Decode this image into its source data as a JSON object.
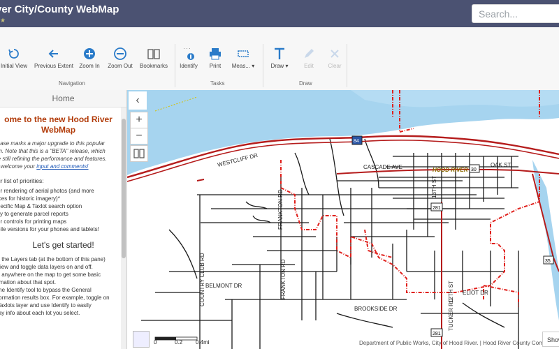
{
  "header": {
    "title": "ver City/County WebMap",
    "search_placeholder": "Search..."
  },
  "ribbon": {
    "tools": [
      {
        "label": "Initial View",
        "icon": "refresh-icon"
      },
      {
        "label": "Previous Extent",
        "icon": "arrow-left-icon"
      },
      {
        "label": "Zoom In",
        "icon": "plus-circle-icon"
      },
      {
        "label": "Zoom Out",
        "icon": "minus-circle-icon"
      },
      {
        "label": "Bookmarks",
        "icon": "book-icon"
      },
      {
        "label": "Identify",
        "icon": "identify-icon"
      },
      {
        "label": "Print",
        "icon": "printer-icon"
      },
      {
        "label": "Meas...",
        "icon": "measure-icon"
      },
      {
        "label": "Draw",
        "icon": "text-icon"
      },
      {
        "label": "Edit",
        "icon": "edit-icon"
      },
      {
        "label": "Clear",
        "icon": "close-icon"
      }
    ],
    "groups": {
      "navigation": "Navigation",
      "tasks": "Tasks",
      "draw": "Draw"
    }
  },
  "panel": {
    "header": "Home",
    "welcome_line1": "ome to the new Hood River",
    "welcome_line2": "WebMap",
    "para_lines": [
      "lease marks a major upgrade to this popular",
      "on.  Note that this is a \"BETA\" release, which",
      "re still refining the performance and features.",
      "e welcome your"
    ],
    "para_link": "input and comments!",
    "priorities_title": "ur list of priorities:",
    "priorities": [
      "er rendering of aerial photos (and more",
      "ices for historic imagery)*",
      "pecific Map & Taxlot search option",
      "ity to generate parcel reports",
      "er controls for printing maps",
      "bile versions for your phones and tablets!"
    ],
    "started": "Let's get started!",
    "steps": [
      "k the Layers tab (at the bottom of this pane)",
      "view and toggle data layers on and off.",
      "k anywhere on the map to get some basic",
      "rmation about that spot.",
      " the Identify tool to bypass the General",
      "formation results box. For example, toggle on",
      " Taxlots layer and use Identify to easily",
      "lay info about each lot you select."
    ]
  },
  "map": {
    "labels": [
      "WESTCLIFF DR",
      "CASCADE AVE",
      "HOOD RIVER",
      "OAK ST",
      "13TH ST",
      "COUNTRY CLUB RD",
      "FRANKTON RD",
      "FRANKTON RD",
      "BELMONT DR",
      "BROOKSIDE DR",
      "TUCKER RD",
      "12TH ST",
      "ELIOT DR",
      "30",
      "281",
      "35",
      "84",
      "281"
    ],
    "scale_labels": [
      "0",
      "0.2",
      "0.4mi"
    ],
    "attribution": "Department of Public Works, City of Hood River. | Hood River County Comm",
    "show_button": "Show",
    "colors": {
      "water": "#a6d4ef",
      "road": "#b51c1c",
      "boundary": "#e0201c"
    }
  }
}
